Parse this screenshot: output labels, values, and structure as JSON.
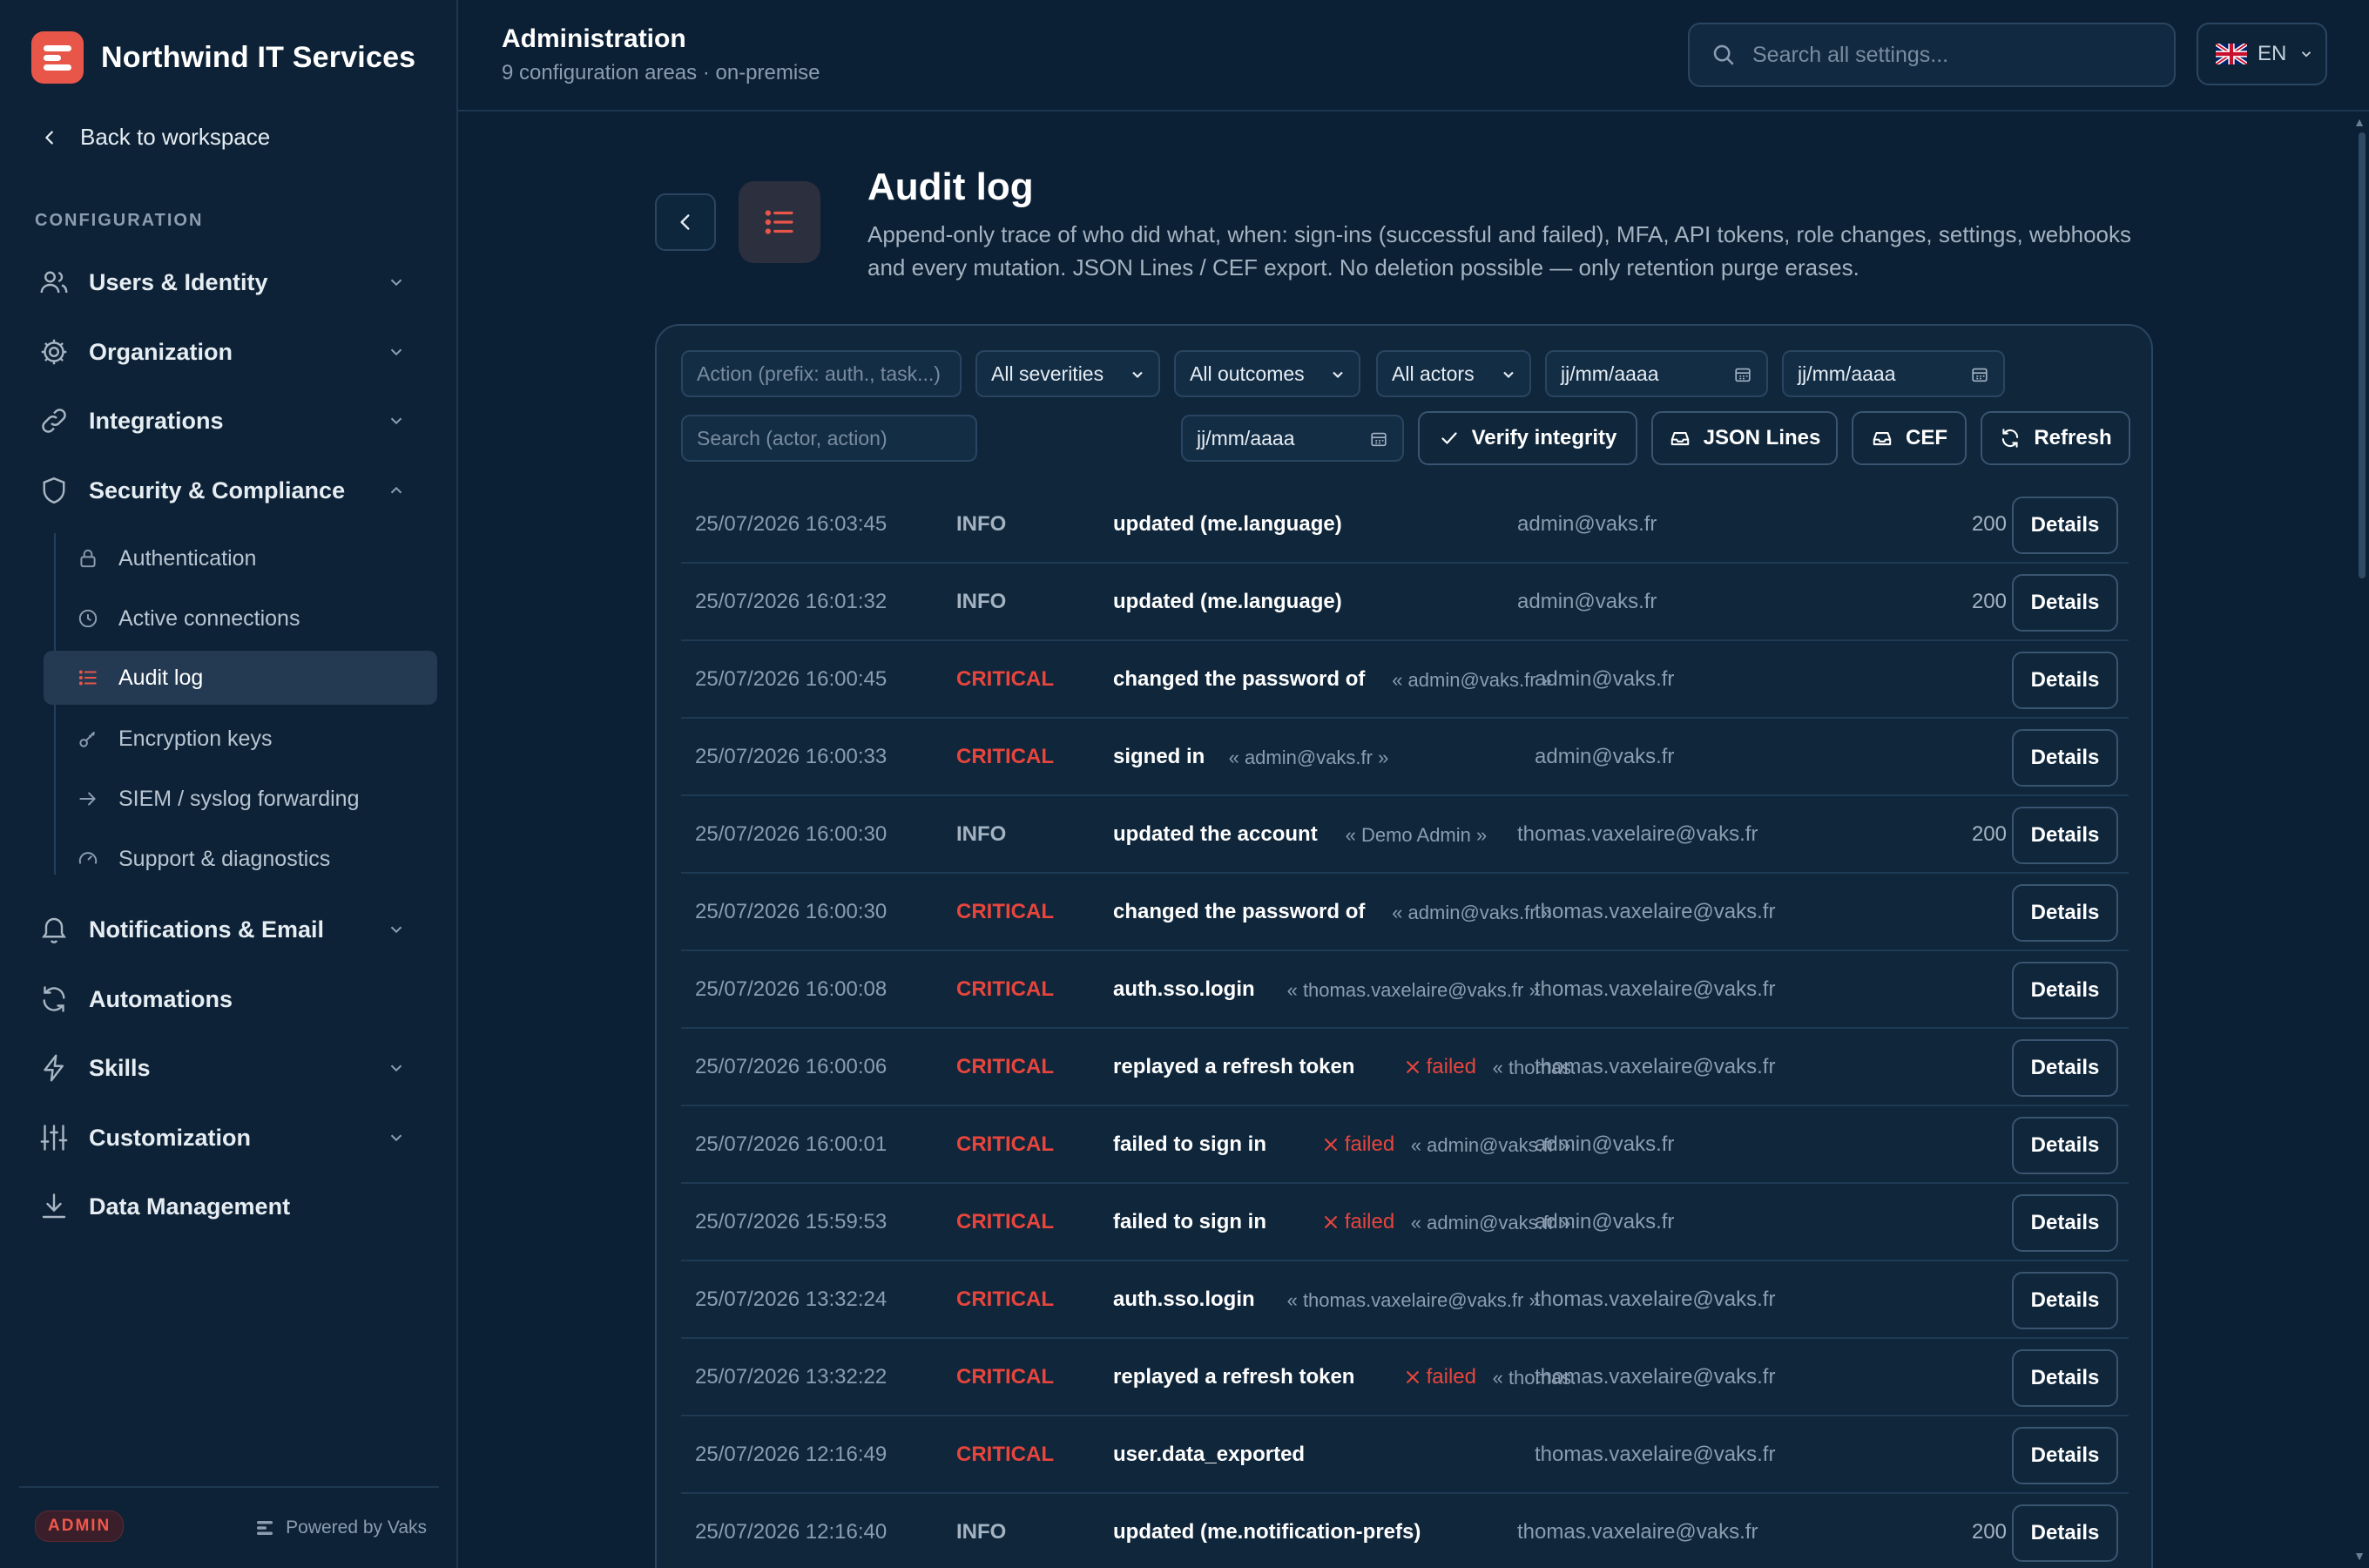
{
  "brand": {
    "name": "Northwind IT Services"
  },
  "sidebar": {
    "back_label": "Back to workspace",
    "section_label": "CONFIGURATION",
    "items": [
      {
        "label": "Users & Identity",
        "icon": "users-icon",
        "expandable": true
      },
      {
        "label": "Organization",
        "icon": "gear-icon",
        "expandable": true
      },
      {
        "label": "Integrations",
        "icon": "link-icon",
        "expandable": true
      },
      {
        "label": "Security & Compliance",
        "icon": "shield-icon",
        "expandable": true,
        "expanded": true
      },
      {
        "label": "Notifications & Email",
        "icon": "bell-icon",
        "expandable": true
      },
      {
        "label": "Automations",
        "icon": "refresh-icon",
        "expandable": false
      },
      {
        "label": "Skills",
        "icon": "bolt-icon",
        "expandable": true
      },
      {
        "label": "Customization",
        "icon": "sliders-icon",
        "expandable": true
      },
      {
        "label": "Data Management",
        "icon": "download-icon",
        "expandable": false
      }
    ],
    "security_sub": [
      {
        "label": "Authentication",
        "icon": "lock-icon"
      },
      {
        "label": "Active connections",
        "icon": "clock-icon"
      },
      {
        "label": "Audit log",
        "icon": "list-icon",
        "active": true
      },
      {
        "label": "Encryption keys",
        "icon": "key-icon"
      },
      {
        "label": "SIEM / syslog forwarding",
        "icon": "arrow-right-icon"
      },
      {
        "label": "Support & diagnostics",
        "icon": "gauge-icon"
      }
    ],
    "footer": {
      "badge": "ADMIN",
      "powered": "Powered by Vaks"
    }
  },
  "topbar": {
    "title": "Administration",
    "subtitle": "9 configuration areas · on-premise",
    "search_placeholder": "Search all settings...",
    "lang": "EN"
  },
  "page": {
    "title": "Audit log",
    "description": "Append-only trace of who did what, when: sign-ins (successful and failed), MFA, API tokens, role changes, settings, webhooks and every mutation. JSON Lines / CEF export. No deletion possible — only retention purge erases."
  },
  "filters": {
    "action_placeholder": "Action (prefix: auth., task...)",
    "severity": "All severities",
    "outcome": "All outcomes",
    "actors": "All actors",
    "date_from": "jj/mm/aaaa",
    "date_to": "jj/mm/aaaa",
    "search_placeholder": "Search (actor, action)",
    "date_extra": "jj/mm/aaaa",
    "verify_label": "Verify integrity",
    "jsonl_label": "JSON Lines",
    "cef_label": "CEF",
    "refresh_label": "Refresh"
  },
  "details_label": "Details",
  "failed_label": "failed",
  "rows": [
    {
      "ts": "25/07/2026 16:03:45",
      "sev": "INFO",
      "action": "updated (me.language)",
      "target": "",
      "failed": false,
      "actor": "admin@vaks.fr",
      "code": "200"
    },
    {
      "ts": "25/07/2026 16:01:32",
      "sev": "INFO",
      "action": "updated (me.language)",
      "target": "",
      "failed": false,
      "actor": "admin@vaks.fr",
      "code": "200"
    },
    {
      "ts": "25/07/2026 16:00:45",
      "sev": "CRITICAL",
      "action": "changed the password of",
      "target": "« admin@vaks.fr »",
      "failed": false,
      "actor": "admin@vaks.fr",
      "code": ""
    },
    {
      "ts": "25/07/2026 16:00:33",
      "sev": "CRITICAL",
      "action": "signed in",
      "target": "« admin@vaks.fr »",
      "failed": false,
      "actor": "admin@vaks.fr",
      "code": ""
    },
    {
      "ts": "25/07/2026 16:00:30",
      "sev": "INFO",
      "action": "updated the account",
      "target": "« Demo Admin »",
      "failed": false,
      "actor": "thomas.vaxelaire@vaks.fr",
      "code": "200"
    },
    {
      "ts": "25/07/2026 16:00:30",
      "sev": "CRITICAL",
      "action": "changed the password of",
      "target": "« admin@vaks.fr »",
      "failed": false,
      "actor": "thomas.vaxelaire@vaks.fr",
      "code": ""
    },
    {
      "ts": "25/07/2026 16:00:08",
      "sev": "CRITICAL",
      "action": "auth.sso.login",
      "target": "« thomas.vaxelaire@vaks.fr »",
      "failed": false,
      "actor": "thomas.vaxelaire@vaks.fr",
      "code": ""
    },
    {
      "ts": "25/07/2026 16:00:06",
      "sev": "CRITICAL",
      "action": "replayed a refresh token",
      "target": "« thomas.",
      "failed": true,
      "actor": "thomas.vaxelaire@vaks.fr",
      "code": ""
    },
    {
      "ts": "25/07/2026 16:00:01",
      "sev": "CRITICAL",
      "action": "failed to sign in",
      "target": "« admin@vaks.fr »",
      "failed": true,
      "actor": "admin@vaks.fr",
      "code": ""
    },
    {
      "ts": "25/07/2026 15:59:53",
      "sev": "CRITICAL",
      "action": "failed to sign in",
      "target": "« admin@vaks.fr »",
      "failed": true,
      "actor": "admin@vaks.fr",
      "code": ""
    },
    {
      "ts": "25/07/2026 13:32:24",
      "sev": "CRITICAL",
      "action": "auth.sso.login",
      "target": "« thomas.vaxelaire@vaks.fr »",
      "failed": false,
      "actor": "thomas.vaxelaire@vaks.fr",
      "code": ""
    },
    {
      "ts": "25/07/2026 13:32:22",
      "sev": "CRITICAL",
      "action": "replayed a refresh token",
      "target": "« thomas.",
      "failed": true,
      "actor": "thomas.vaxelaire@vaks.fr",
      "code": ""
    },
    {
      "ts": "25/07/2026 12:16:49",
      "sev": "CRITICAL",
      "action": "user.data_exported",
      "target": "",
      "failed": false,
      "actor": "thomas.vaxelaire@vaks.fr",
      "code": ""
    },
    {
      "ts": "25/07/2026 12:16:40",
      "sev": "INFO",
      "action": "updated (me.notification-prefs)",
      "target": "",
      "failed": false,
      "actor": "thomas.vaxelaire@vaks.fr",
      "code": "200"
    }
  ],
  "colors": {
    "accent": "#e8564a",
    "critical": "#e8453c",
    "bg": "#0b2034",
    "panel": "#0f263b"
  }
}
